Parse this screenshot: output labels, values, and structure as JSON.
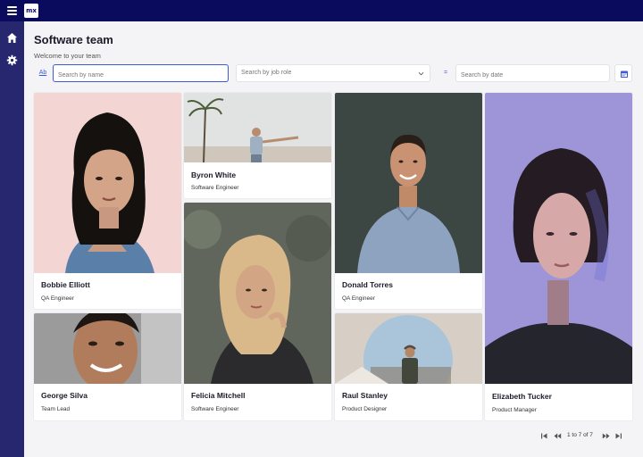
{
  "app": {
    "logo_text": "mx"
  },
  "header": {
    "title": "Software team",
    "subtitle": "Welcome to your team"
  },
  "filters": {
    "name_prefix": "Ab",
    "name_placeholder": "Search by name",
    "role_placeholder": "Search by job role",
    "date_prefix": "=",
    "date_placeholder": "Search by date"
  },
  "cards": [
    {
      "name": "Bobbie Elliott",
      "role": "QA Engineer"
    },
    {
      "name": "Byron White",
      "role": "Software Engineer"
    },
    {
      "name": "Donald Torres",
      "role": "QA Engineer"
    },
    {
      "name": "Elizabeth Tucker",
      "role": "Product Manager"
    },
    {
      "name": "George Silva",
      "role": "Team Lead"
    },
    {
      "name": "Felicia Mitchell",
      "role": "Software Engineer"
    },
    {
      "name": "Raul Stanley",
      "role": "Product Designer"
    }
  ],
  "pagination": {
    "summary": "1 to 7 of 7"
  },
  "colors": {
    "topbar": "#0b0b5e",
    "sidebar": "#272770",
    "accent": "#3b5bdb"
  },
  "icons": [
    "menu-icon",
    "home-icon",
    "gear-icon",
    "chevron-down-icon",
    "calendar-icon",
    "first-page-icon",
    "prev-page-icon",
    "next-page-icon",
    "last-page-icon"
  ]
}
